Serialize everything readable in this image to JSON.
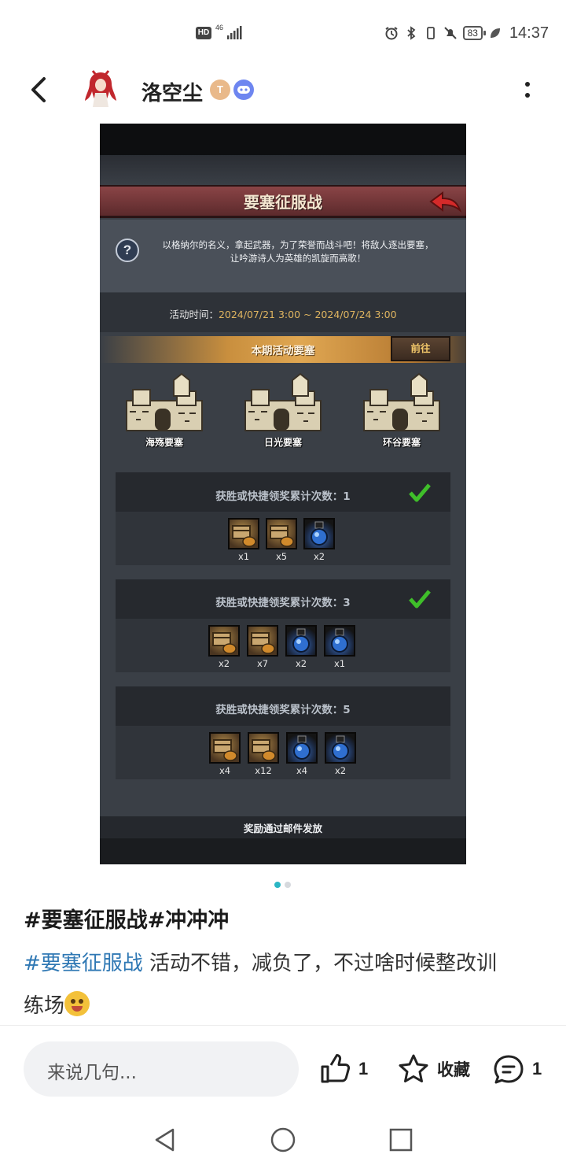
{
  "status_bar": {
    "hd_label": "HD",
    "network_label": "46",
    "battery_level": "83",
    "time": "14:37"
  },
  "header": {
    "username": "洛空尘",
    "badge_t_label": "T",
    "icons": [
      "back-arrow-icon",
      "avatar",
      "game-controller-icon",
      "more-vertical-icon"
    ]
  },
  "game": {
    "title": "要塞征服战",
    "description_line1": "以格纳尔的名义，拿起武器，为了荣誉而战斗吧！将敌人逐出要塞，",
    "description_line2": "让吟游诗人为英雄的凯旋而高歌！",
    "question_label": "?",
    "time_label": "活动时间：",
    "time_value": "2024/07/21 3:00 ~ 2024/07/24 3:00",
    "fortress_section_title": "本期活动要塞",
    "goto_label": "前往",
    "fortresses": [
      {
        "name": "海殇要塞"
      },
      {
        "name": "日光要塞"
      },
      {
        "name": "环谷要塞"
      }
    ],
    "reward_tiers": [
      {
        "title": "获胜或快捷领奖累计次数：1",
        "claimed": true,
        "items": [
          {
            "kind": "chest",
            "qty": "x1"
          },
          {
            "kind": "chest",
            "qty": "x5"
          },
          {
            "kind": "potion",
            "qty": "x2"
          }
        ]
      },
      {
        "title": "获胜或快捷领奖累计次数：3",
        "claimed": true,
        "items": [
          {
            "kind": "chest",
            "qty": "x2"
          },
          {
            "kind": "chest",
            "qty": "x7"
          },
          {
            "kind": "potion",
            "qty": "x2"
          },
          {
            "kind": "potion",
            "qty": "x1"
          }
        ]
      },
      {
        "title": "获胜或快捷领奖累计次数：5",
        "claimed": false,
        "items": [
          {
            "kind": "chest",
            "qty": "x4"
          },
          {
            "kind": "chest",
            "qty": "x12"
          },
          {
            "kind": "potion",
            "qty": "x4"
          },
          {
            "kind": "potion",
            "qty": "x2"
          }
        ]
      }
    ],
    "footer": "奖励通过邮件发放"
  },
  "carousel": {
    "pages": 2,
    "active": 1
  },
  "post": {
    "title": "#要塞征服战#冲冲冲",
    "tag": "#要塞征服战",
    "body_line1": " 活动不错，减负了，不过啥时候整改训",
    "body_line2": "练场"
  },
  "actions": {
    "comment_placeholder": "来说几句...",
    "like_count": "1",
    "favorite_label": "收藏",
    "comment_count": "1"
  },
  "colors": {
    "tag_blue": "#2f78b4",
    "pager_active": "#2bb6c4",
    "game_gold": "#e0b560",
    "title_bar_red": "#8a4446"
  }
}
